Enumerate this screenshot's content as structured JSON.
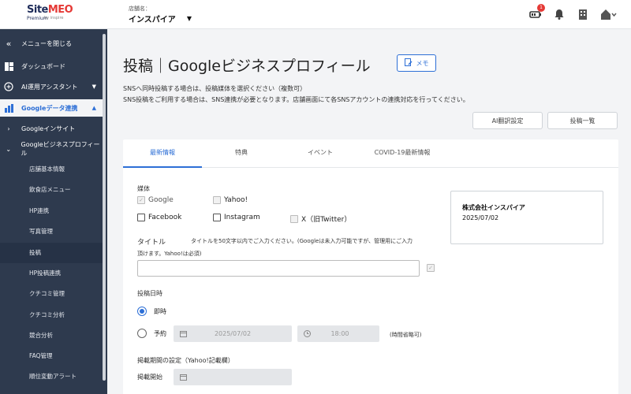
{
  "header": {
    "logo_site": "Site",
    "logo_meo": "MEO",
    "logo_premium": "Premium",
    "logo_company": "by inspire",
    "store_label": "店舗名：",
    "store_name": "インスパイア",
    "notification_count": "1"
  },
  "sidebar": {
    "close_menu": "メニューを閉じる",
    "items": [
      {
        "label": "ダッシュボード"
      },
      {
        "label": "AI運用アシスタント"
      },
      {
        "label": "Googleデータ連携"
      },
      {
        "label": "Googleインサイト"
      },
      {
        "label": "Googleビジネスプロフィール"
      }
    ],
    "subitems": [
      "店舗基本情報",
      "飲食店メニュー",
      "HP連携",
      "写真管理",
      "投稿",
      "HP投稿連携",
      "クチコミ管理",
      "クチコミ分析",
      "競合分析",
      "FAQ管理",
      "順位変動アラート"
    ]
  },
  "main": {
    "title": "投稿｜Googleビジネスプロフィール",
    "memo_label": "メモ",
    "notice1": "SNSへ同時投稿する場合は、投稿媒体を選択ください（複数可）",
    "notice2": "SNS投稿をご利用する場合は、SNS連携が必要となります。店舗画面にて各SNSアカウントの連携対応を行ってください。",
    "ai_translate": "AI翻訳設定",
    "post_list": "投稿一覧",
    "tabs": [
      "最新情報",
      "特典",
      "イベント",
      "COVID-19最新情報"
    ],
    "media_label": "媒体",
    "media": [
      "Google",
      "Yahoo!",
      "Facebook",
      "Instagram",
      "X（旧Twitter）"
    ],
    "title_label": "タイトル",
    "title_hint": "タイトルを50文字以内でご入力ください。(Googleは未入力可能ですが、管理用にご入力",
    "title_hint2": "頂けます。Yahoo!は必須)",
    "post_datetime_label": "投稿日時",
    "immediate": "即時",
    "scheduled": "予約",
    "date_value": "2025/07/02",
    "time_value": "18:00",
    "time_note": "(時間省略可)",
    "period_label": "掲載期間の設定（Yahoo!記載欄）",
    "start_label": "掲載開始",
    "preview_name": "株式会社インスパイア",
    "preview_date": "2025/07/02"
  }
}
